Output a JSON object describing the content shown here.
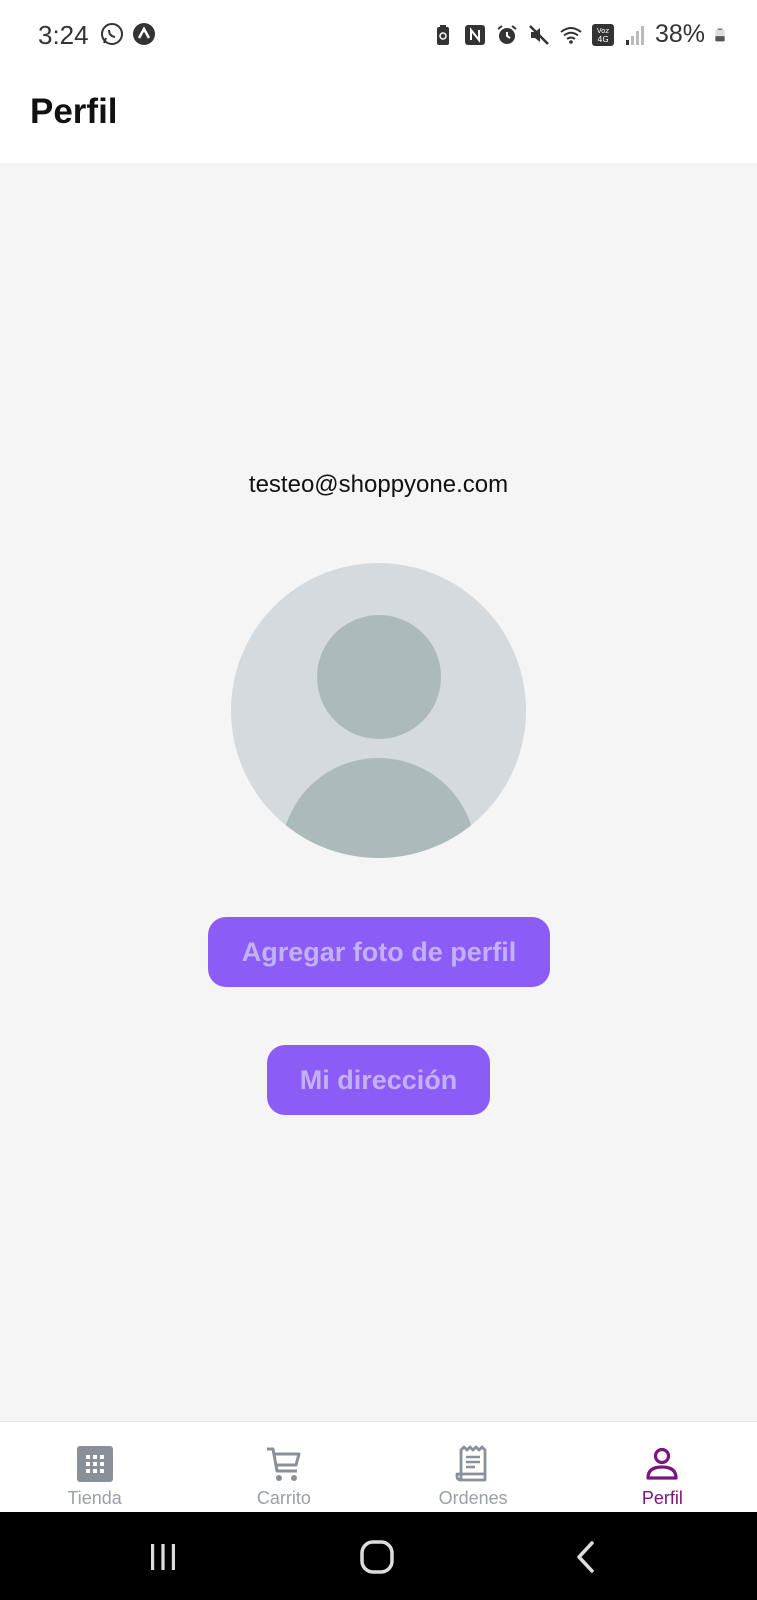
{
  "status_bar": {
    "time": "3:24",
    "battery": "38%",
    "icons": [
      "whatsapp-icon",
      "a-app-icon",
      "battery-saver-icon",
      "nfc-icon",
      "alarm-icon",
      "mute-icon",
      "wifi-icon",
      "volte-4g-icon",
      "signal-icon",
      "battery-icon"
    ]
  },
  "header": {
    "title": "Perfil"
  },
  "profile": {
    "email": "testeo@shoppyone.com",
    "add_photo_label": "Agregar foto de perfil",
    "address_label": "Mi dirección"
  },
  "colors": {
    "accent": "#8b5cf6",
    "active_tab": "#7a1580",
    "inactive_tab": "#9aa0a6"
  },
  "bottom_nav": {
    "items": [
      {
        "label": "Tienda",
        "icon": "store-grid-icon",
        "active": false
      },
      {
        "label": "Carrito",
        "icon": "cart-icon",
        "active": false
      },
      {
        "label": "Ordenes",
        "icon": "receipt-icon",
        "active": false
      },
      {
        "label": "Perfil",
        "icon": "person-icon",
        "active": true
      }
    ]
  },
  "system_nav": {
    "icons": [
      "recents-icon",
      "home-icon",
      "back-icon"
    ]
  }
}
